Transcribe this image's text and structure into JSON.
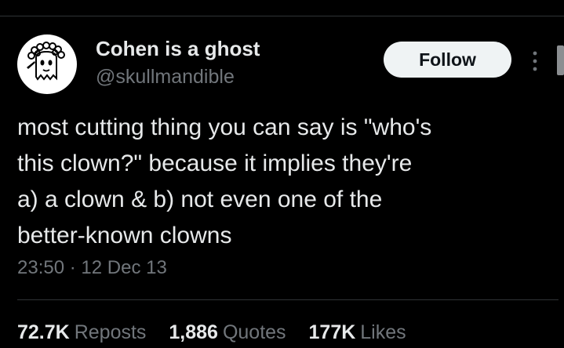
{
  "author": {
    "display_name": "Cohen is a ghost",
    "handle": "@skullmandible",
    "avatar_icon": "ghost-doodle-icon"
  },
  "actions": {
    "follow_label": "Follow",
    "more_icon": "more-dots-icon"
  },
  "tweet": {
    "lines": [
      "most cutting thing you can say is \"who's",
      "this clown?\" because it implies they're",
      "a) a clown & b) not even one of the",
      "better-known clowns"
    ],
    "time": "23:50",
    "separator": "·",
    "date": "12 Dec 13"
  },
  "stats": [
    {
      "value": "72.7K",
      "label": "Reposts"
    },
    {
      "value": "1,886",
      "label": "Quotes"
    },
    {
      "value": "177K",
      "label": "Likes"
    }
  ],
  "colors": {
    "background": "#000000",
    "text_primary": "#e7e9ea",
    "text_secondary": "#71767b",
    "divider": "#2f3336",
    "follow_bg": "#eff3f4"
  }
}
